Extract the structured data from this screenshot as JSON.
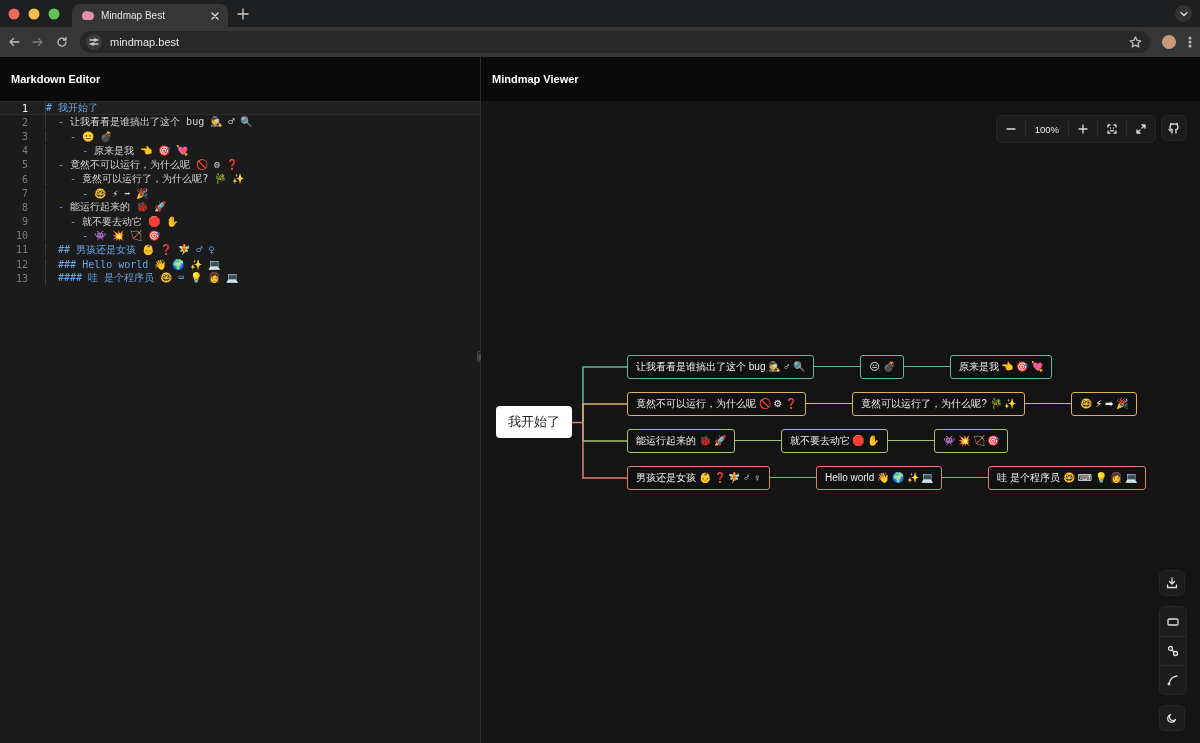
{
  "browser": {
    "tab_title": "Mindmap Best",
    "url": "mindmap.best"
  },
  "editor": {
    "title": "Markdown Editor",
    "lines": [
      {
        "number": "1",
        "kind": "heading",
        "text": "# 我开始了",
        "active": true
      },
      {
        "number": "2",
        "kind": "list",
        "text": "  - 让我看看是谁搞出了这个 bug 🕵 ♂ 🔍",
        "active": false
      },
      {
        "number": "3",
        "kind": "list",
        "text": "    - 😐 💣",
        "active": false
      },
      {
        "number": "4",
        "kind": "list",
        "text": "      - 原来是我 👈 🎯 💘",
        "active": false
      },
      {
        "number": "5",
        "kind": "list",
        "text": "  - 竟然不可以运行，为什么呢 🚫 ⚙ ❓",
        "active": false
      },
      {
        "number": "6",
        "kind": "list",
        "text": "    - 竟然可以运行了，为什么呢? 🎋 ✨",
        "active": false
      },
      {
        "number": "7",
        "kind": "list",
        "text": "      - 🤓 ⚡ ➡ 🎉",
        "active": false
      },
      {
        "number": "8",
        "kind": "list",
        "text": "  - 能运行起来的 🐞 🚀",
        "active": false
      },
      {
        "number": "9",
        "kind": "list",
        "text": "    - 就不要去动它 🛑 ✋",
        "active": false
      },
      {
        "number": "10",
        "kind": "list",
        "text": "      - 👾 💥 🏹 🎯",
        "active": false
      },
      {
        "number": "11",
        "kind": "heading",
        "text": "  ## 男孩还是女孩 👶 ❓ 🧚 ♂ ♀",
        "active": false
      },
      {
        "number": "12",
        "kind": "heading",
        "text": "  ### Hello world 👋 🌍 ✨ 💻",
        "active": false
      },
      {
        "number": "13",
        "kind": "heading",
        "text": "  #### 哇 是个程序员 🤓 ⌨ 💡 👩 💻",
        "active": false
      }
    ]
  },
  "viewer": {
    "title": "Mindmap Viewer",
    "zoom": "100%",
    "mindmap": {
      "root": {
        "text": "我开始了",
        "children": [
          {
            "text": "让我看看是谁搞出了这个 bug 🕵 ♂ 🔍",
            "color": "#5fb89a",
            "children": [
              {
                "text": "😐 💣",
                "children": [
                  {
                    "text": "原来是我 👈 🎯 💘"
                  }
                ]
              }
            ]
          },
          {
            "text": "竟然不可以运行，为什么呢 🚫 ⚙ ❓",
            "color": "#d8b45c",
            "children": [
              {
                "text": "竟然可以运行了，为什么呢? 🎋 ✨",
                "children": [
                  {
                    "text": "🤓 ⚡ ➡ 🎉"
                  }
                ]
              }
            ]
          },
          {
            "text": "能运行起来的 🐞 🚀",
            "color": "#a6c66e",
            "children": [
              {
                "text": "就不要去动它 🛑 ✋",
                "children": [
                  {
                    "text": "👾 💥 🏹 🎯"
                  }
                ]
              }
            ]
          },
          {
            "text": "男孩还是女孩 👶 ❓ 🧚 ♂ ♀",
            "color": "#df7f78",
            "children": [
              {
                "text": "Hello world 👋 🌍 ✨ 💻",
                "children": [
                  {
                    "text": "哇 是个程序员 🤓 ⌨ 💡 👩 💻"
                  }
                ]
              }
            ]
          }
        ]
      }
    }
  }
}
